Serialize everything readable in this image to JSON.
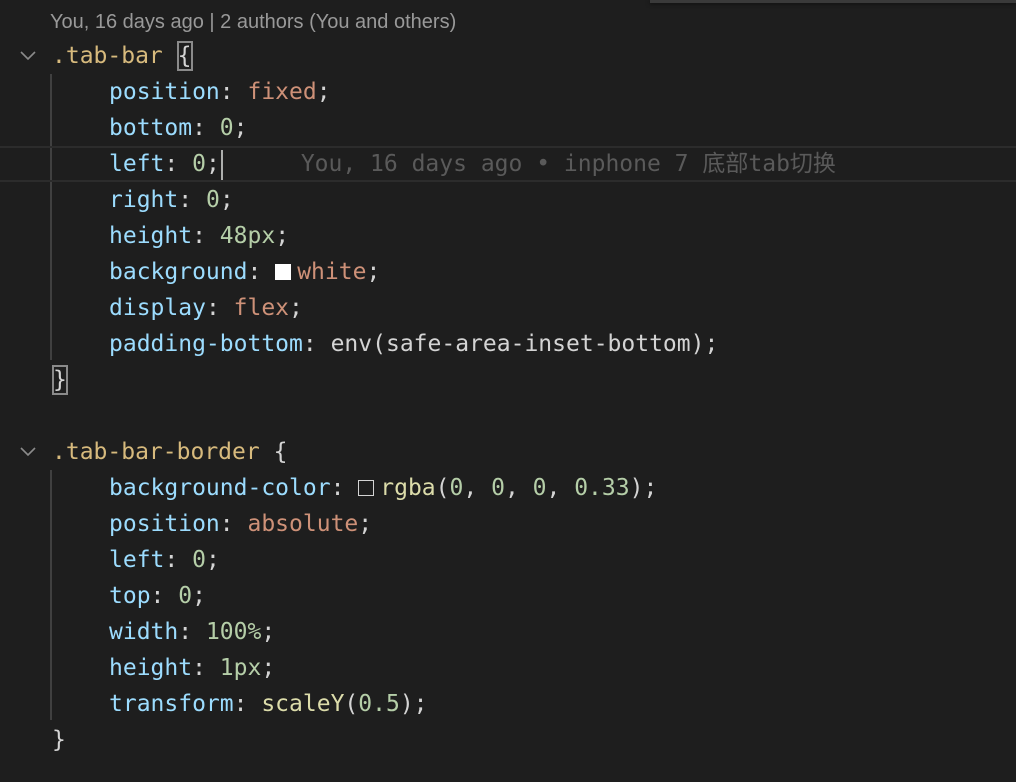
{
  "codelens": "You, 16 days ago | 2 authors (You and others)",
  "inline_blame": "You, 16 days ago • inphone 7 底部tab切换",
  "colors": {
    "background": "#1e1e1e",
    "selector": "#d7ba7d",
    "property": "#9cdcfe",
    "string_value": "#ce9178",
    "number": "#b5cea8",
    "function": "#dcdcaa",
    "swatch_white": "#ffffff",
    "swatch_rgba": "rgba(0, 0, 0, 0.33)"
  },
  "rule1": {
    "selector": ".tab-bar",
    "open": "{",
    "close": "}",
    "decls": [
      {
        "prop": "position",
        "value": "fixed"
      },
      {
        "prop": "bottom",
        "value": "0"
      },
      {
        "prop": "left",
        "value": "0"
      },
      {
        "prop": "right",
        "value": "0"
      },
      {
        "prop": "height",
        "value": "48px"
      },
      {
        "prop": "background",
        "value": "white"
      },
      {
        "prop": "display",
        "value": "flex"
      },
      {
        "prop": "padding-bottom",
        "func": "env",
        "arg": "safe-area-inset-bottom"
      }
    ]
  },
  "rule2": {
    "selector": ".tab-bar-border",
    "open": "{",
    "close": "}",
    "decls": [
      {
        "prop": "background-color",
        "func": "rgba",
        "args": [
          "0",
          "0",
          "0",
          "0.33"
        ]
      },
      {
        "prop": "position",
        "value": "absolute"
      },
      {
        "prop": "left",
        "value": "0"
      },
      {
        "prop": "top",
        "value": "0"
      },
      {
        "prop": "width",
        "value": "100%"
      },
      {
        "prop": "height",
        "value": "1px"
      },
      {
        "prop": "transform",
        "func": "scaleY",
        "arg": "0.5"
      }
    ]
  }
}
